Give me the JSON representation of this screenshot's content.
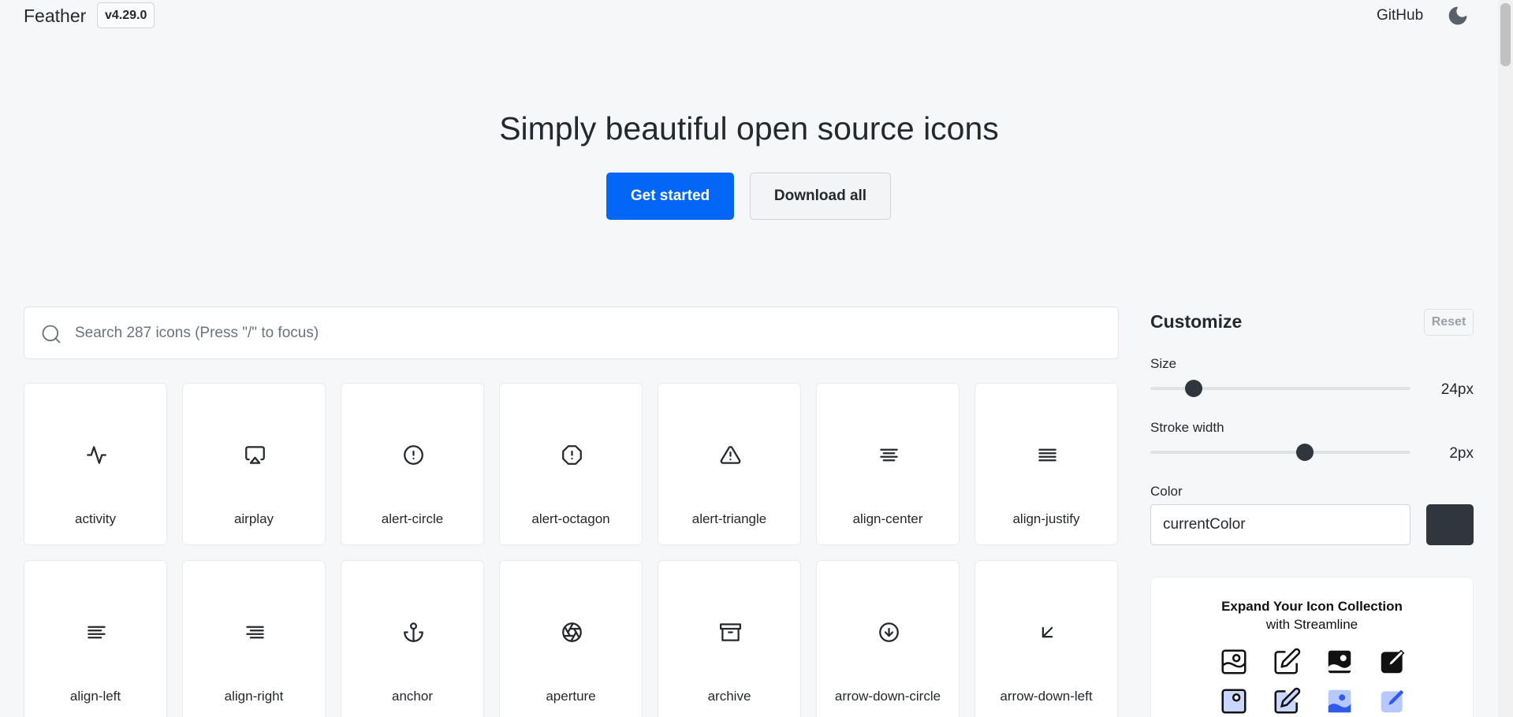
{
  "header": {
    "brand": "Feather",
    "version": "v4.29.0",
    "github_label": "GitHub",
    "theme_icon": "moon-icon"
  },
  "hero": {
    "title": "Simply beautiful open source icons",
    "primary_button": "Get started",
    "secondary_button": "Download all"
  },
  "search": {
    "placeholder": "Search 287 icons (Press \"/\" to focus)",
    "icon": "search-icon"
  },
  "icons": [
    {
      "label": "activity",
      "icon": "activity-icon"
    },
    {
      "label": "airplay",
      "icon": "airplay-icon"
    },
    {
      "label": "alert-circle",
      "icon": "alert-circle-icon"
    },
    {
      "label": "alert-octagon",
      "icon": "alert-octagon-icon"
    },
    {
      "label": "alert-triangle",
      "icon": "alert-triangle-icon"
    },
    {
      "label": "align-center",
      "icon": "align-center-icon"
    },
    {
      "label": "align-justify",
      "icon": "align-justify-icon"
    },
    {
      "label": "align-left",
      "icon": "align-left-icon"
    },
    {
      "label": "align-right",
      "icon": "align-right-icon"
    },
    {
      "label": "anchor",
      "icon": "anchor-icon"
    },
    {
      "label": "aperture",
      "icon": "aperture-icon"
    },
    {
      "label": "archive",
      "icon": "archive-icon"
    },
    {
      "label": "arrow-down-circle",
      "icon": "arrow-down-circle-icon"
    },
    {
      "label": "arrow-down-left",
      "icon": "arrow-down-left-icon"
    }
  ],
  "customize": {
    "title": "Customize",
    "reset_label": "Reset",
    "size": {
      "label": "Size",
      "value_text": "24px",
      "value": 24,
      "min": 12,
      "max": 96
    },
    "stroke": {
      "label": "Stroke width",
      "value_text": "2px",
      "value": 2,
      "min": 0.5,
      "max": 3
    },
    "color": {
      "label": "Color",
      "value": "currentColor",
      "swatch": "#2f363d"
    }
  },
  "promo": {
    "title": "Expand Your Icon Collection",
    "subtitle": "with Streamline"
  },
  "colors": {
    "accent": "#0366f7",
    "text": "#24292e",
    "background": "#f5f7f9"
  }
}
